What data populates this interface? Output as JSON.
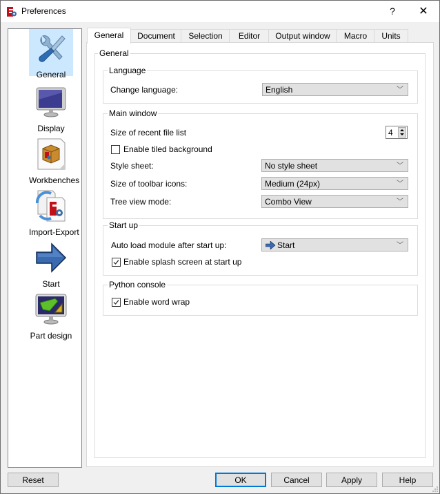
{
  "window": {
    "title": "Preferences",
    "help_label": "?",
    "close_label": "✕"
  },
  "sidebar": {
    "items": [
      {
        "label": "General",
        "icon": "tools-icon",
        "selected": true
      },
      {
        "label": "Display",
        "icon": "monitor-icon",
        "selected": false
      },
      {
        "label": "Workbenches",
        "icon": "workbench-box-icon",
        "selected": false
      },
      {
        "label": "Import-Export",
        "icon": "import-export-icon",
        "selected": false
      },
      {
        "label": "Start",
        "icon": "arrow-right-icon",
        "selected": false
      },
      {
        "label": "Part design",
        "icon": "part-design-icon",
        "selected": false
      }
    ]
  },
  "tabs": [
    {
      "label": "General",
      "active": true
    },
    {
      "label": "Document",
      "active": false
    },
    {
      "label": "Selection",
      "active": false
    },
    {
      "label": "Editor",
      "active": false
    },
    {
      "label": "Output window",
      "active": false
    },
    {
      "label": "Macro",
      "active": false
    },
    {
      "label": "Units",
      "active": false
    }
  ],
  "general": {
    "title": "General",
    "language": {
      "title": "Language",
      "change_language_label": "Change language:",
      "change_language_value": "English"
    },
    "main_window": {
      "title": "Main window",
      "recent_files_label": "Size of recent file list",
      "recent_files_value": "4",
      "tiled_bg_label": "Enable tiled background",
      "tiled_bg_checked": false,
      "style_sheet_label": "Style sheet:",
      "style_sheet_value": "No style sheet",
      "toolbar_icons_label": "Size of toolbar icons:",
      "toolbar_icons_value": "Medium (24px)",
      "tree_view_label": "Tree view mode:",
      "tree_view_value": "Combo View"
    },
    "startup": {
      "title": "Start up",
      "auto_load_label": "Auto load module after start up:",
      "auto_load_value": "Start",
      "splash_label": "Enable splash screen at start up",
      "splash_checked": true
    },
    "python_console": {
      "title": "Python console",
      "word_wrap_label": "Enable word wrap",
      "word_wrap_checked": true
    }
  },
  "buttons": {
    "reset": "Reset",
    "ok": "OK",
    "cancel": "Cancel",
    "apply": "Apply",
    "help": "Help"
  },
  "colors": {
    "selection_bg": "#cce8ff",
    "default_button_border": "#0078d7"
  }
}
